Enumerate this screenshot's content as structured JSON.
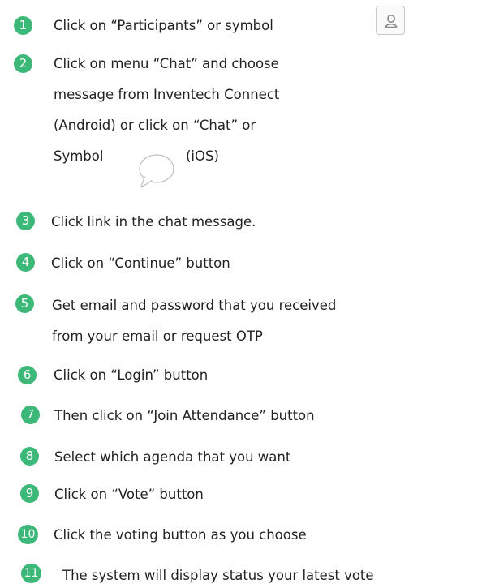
{
  "colors": {
    "badge": "#3cb878",
    "badge_text": "#ffffff",
    "text": "#222222"
  },
  "icons": {
    "participants": "person-icon",
    "chat": "chat-bubble-icon"
  },
  "steps": [
    {
      "number": "1",
      "lines": [
        "Click on “Participants” or symbol"
      ]
    },
    {
      "number": "2",
      "lines": [
        "Click on menu “Chat” and choose",
        "message from Inventech Connect",
        "(Android) or click on “Chat” or",
        "Symbol",
        "(iOS)"
      ]
    },
    {
      "number": "3",
      "lines": [
        "Click link in the chat message."
      ]
    },
    {
      "number": "4",
      "lines": [
        "Click on “Continue” button"
      ]
    },
    {
      "number": "5",
      "lines": [
        "Get email and password that you received",
        "from your email or request OTP"
      ]
    },
    {
      "number": "6",
      "lines": [
        "Click on “Login” button"
      ]
    },
    {
      "number": "7",
      "lines": [
        "Then click on “Join Attendance” button"
      ]
    },
    {
      "number": "8",
      "lines": [
        "Select which agenda that you want"
      ]
    },
    {
      "number": "9",
      "lines": [
        "Click on “Vote” button"
      ]
    },
    {
      "number": "10",
      "lines": [
        "Click the voting button as you choose"
      ]
    },
    {
      "number": "11",
      "lines": [
        "The system will display status your latest vote"
      ]
    }
  ]
}
